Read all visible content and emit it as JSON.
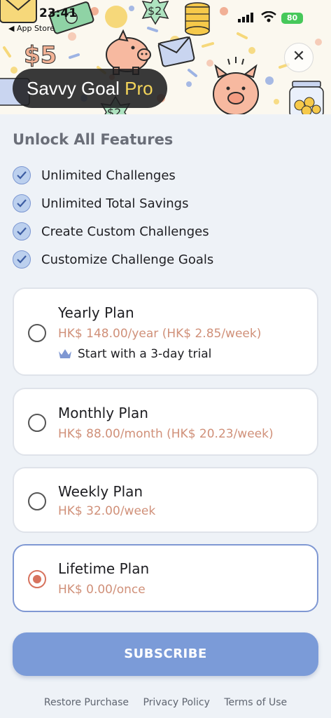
{
  "status_bar": {
    "time": "23:41",
    "back_app": "◀ App Store",
    "battery": "80"
  },
  "header": {
    "brand_main": "Savvy Goal ",
    "brand_pro": "Pro",
    "close_icon": "close-icon",
    "decor_labels": [
      "$5",
      "$2",
      "$2"
    ]
  },
  "features": {
    "title": "Unlock All Features",
    "items": [
      "Unlimited Challenges",
      "Unlimited Total Savings",
      "Create Custom Challenges",
      "Customize Challenge Goals"
    ]
  },
  "plans": [
    {
      "name": "Yearly Plan",
      "price": "HK$ 148.00/year (HK$ 2.85/week)",
      "trial": "Start with a 3-day trial",
      "selected": false
    },
    {
      "name": "Monthly Plan",
      "price": "HK$ 88.00/month (HK$ 20.23/week)",
      "selected": false
    },
    {
      "name": "Weekly Plan",
      "price": "HK$ 32.00/week",
      "selected": false
    },
    {
      "name": "Lifetime Plan",
      "price": "HK$ 0.00/once",
      "selected": true
    }
  ],
  "subscribe_label": "SUBSCRIBE",
  "footer": {
    "restore": "Restore Purchase",
    "privacy": "Privacy Policy",
    "terms": "Terms of Use"
  },
  "colors": {
    "accent": "#7b9bd8",
    "price": "#d09079",
    "selected_radio": "#d7735e",
    "brand_pro": "#f3d45a"
  }
}
